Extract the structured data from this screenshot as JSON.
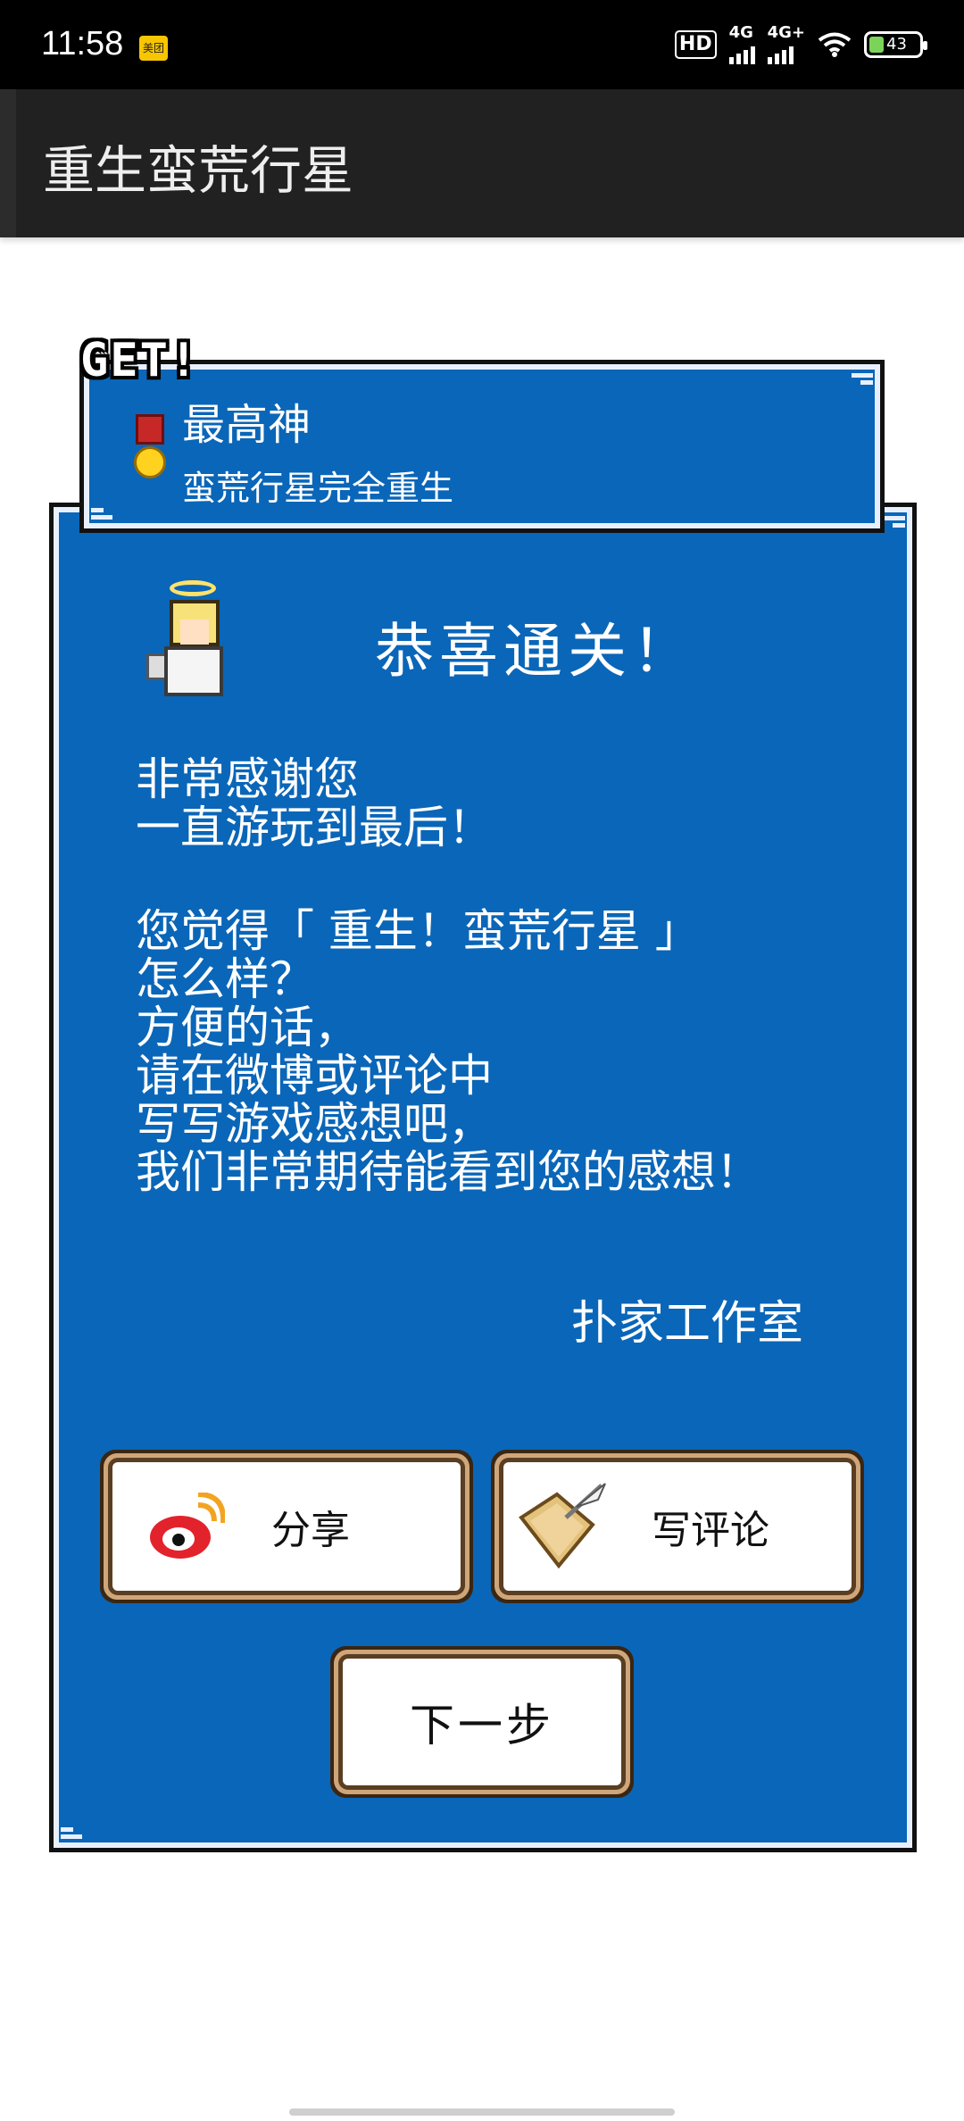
{
  "status_bar": {
    "time": "11:58",
    "notification_icon_label": "美团",
    "hd_label": "HD",
    "network_1": "4G",
    "network_2": "4G+",
    "battery": "43"
  },
  "app_bar": {
    "title": "重生蛮荒行星"
  },
  "achievement": {
    "get_label": "GET!",
    "title": "最高神",
    "subtitle": "蛮荒行星完全重生"
  },
  "dialog": {
    "heading": "恭喜通关！",
    "thanks": "非常感谢您\n一直游玩到最后！",
    "body": "您觉得「 重生！蛮荒行星 」\n怎么样？\n方便的话，\n请在微博或评论中\n写写游戏感想吧，\n我们非常期待能看到您的感想！",
    "signature": "扑家工作室"
  },
  "buttons": {
    "share_label": "分享",
    "review_label": "写评论",
    "next_label": "下一步"
  },
  "colors": {
    "panel_blue": "#0a66b8",
    "app_bar": "#212121",
    "button_border": "#cfa67a"
  }
}
